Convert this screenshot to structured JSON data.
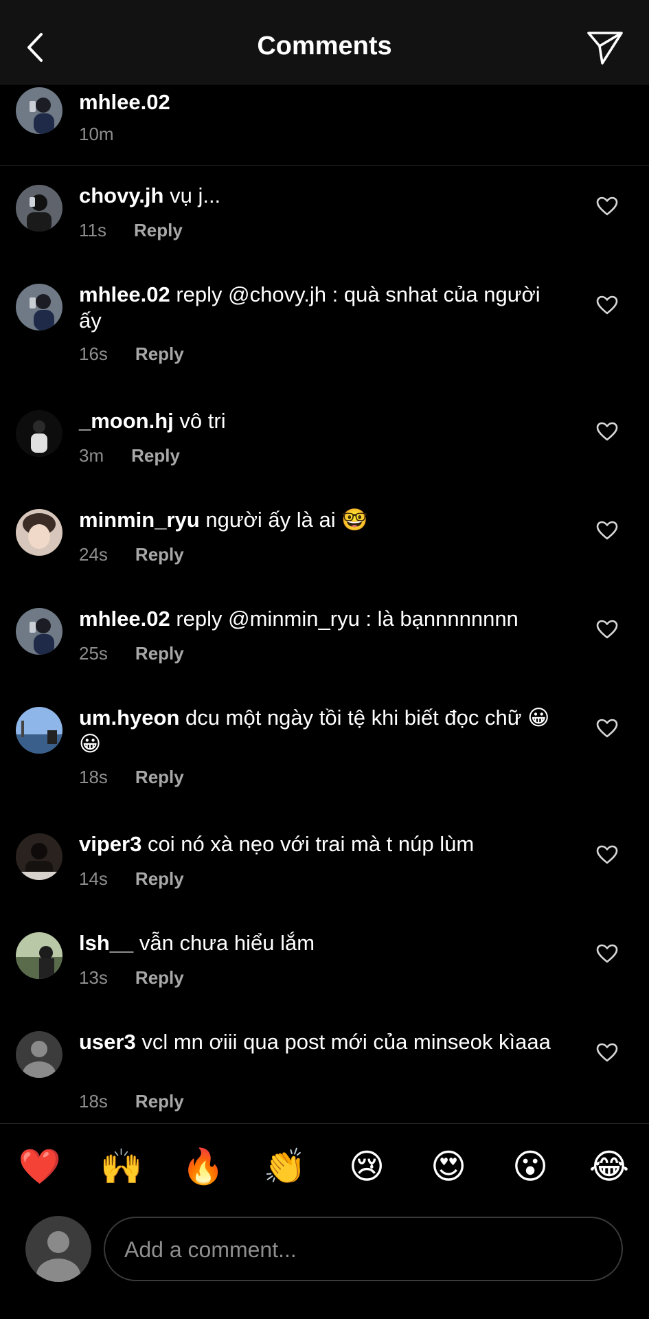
{
  "header": {
    "title": "Comments",
    "back_icon": "chevron-left-icon",
    "send_icon": "paper-plane-icon"
  },
  "caption": {
    "username": "mhlee.02",
    "time": "10m"
  },
  "comments": [
    {
      "username": "chovy.jh",
      "text": "vụ j...",
      "time": "11s",
      "reply_label": "Reply"
    },
    {
      "username": "mhlee.02",
      "text": "reply @chovy.jh : quà snhat của người ấy",
      "time": "16s",
      "reply_label": "Reply"
    },
    {
      "username": "_moon.hj",
      "text": "vô tri",
      "time": "3m",
      "reply_label": "Reply"
    },
    {
      "username": "minmin_ryu",
      "text": "người ấy là ai 🤓",
      "time": "24s",
      "reply_label": "Reply"
    },
    {
      "username": "mhlee.02",
      "text": "reply @minmin_ryu : là bạnnnnnnnn",
      "time": "25s",
      "reply_label": "Reply"
    },
    {
      "username": "um.hyeon",
      "text": "dcu một ngày tồi tệ khi biết đọc chữ 😀😀",
      "time": "18s",
      "reply_label": "Reply"
    },
    {
      "username": "viper3",
      "text": "coi nó xà nẹo với trai mà t núp lùm",
      "time": "14s",
      "reply_label": "Reply"
    },
    {
      "username": "lsh__",
      "text": "vẫn chưa hiểu lắm",
      "time": "13s",
      "reply_label": "Reply"
    },
    {
      "username": "user3",
      "text": "vcl mn ơiii qua post mới của minseok kìaaa",
      "time": "18s",
      "reply_label": "Reply"
    }
  ],
  "emoji_bar": [
    "❤️",
    "🙌",
    "🔥",
    "👏",
    "😢",
    "😍",
    "😮",
    "😂"
  ],
  "composer": {
    "placeholder": "Add a comment..."
  }
}
